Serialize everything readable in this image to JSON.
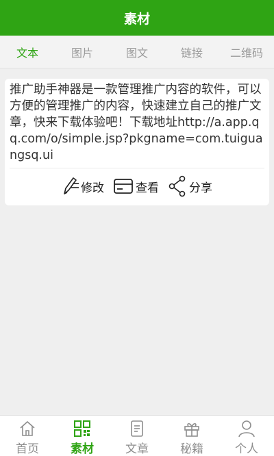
{
  "header": {
    "title": "素材"
  },
  "tabs": [
    {
      "label": "文本",
      "active": true
    },
    {
      "label": "图片",
      "active": false
    },
    {
      "label": "图文",
      "active": false
    },
    {
      "label": "链接",
      "active": false
    },
    {
      "label": "二维码",
      "active": false
    }
  ],
  "card": {
    "text": "推广助手神器是一款管理推广内容的软件，可以方便的管理推广的内容，快速建立自己的推广文章，快来下载体验吧！下载地址http://a.app.qq.com/o/simple.jsp?pkgname=com.tuiguangsq.ui",
    "actions": {
      "edit_label": "修改",
      "view_label": "查看",
      "share_label": "分享"
    }
  },
  "bottom_nav": [
    {
      "label": "首页",
      "icon": "home-icon",
      "active": false
    },
    {
      "label": "素材",
      "icon": "grid-icon",
      "active": true
    },
    {
      "label": "文章",
      "icon": "document-icon",
      "active": false
    },
    {
      "label": "秘籍",
      "icon": "gift-icon",
      "active": false
    },
    {
      "label": "个人",
      "icon": "user-icon",
      "active": false
    }
  ],
  "colors": {
    "accent": "#2fa414",
    "inactive": "#8e8e8e",
    "background": "#efefef"
  }
}
